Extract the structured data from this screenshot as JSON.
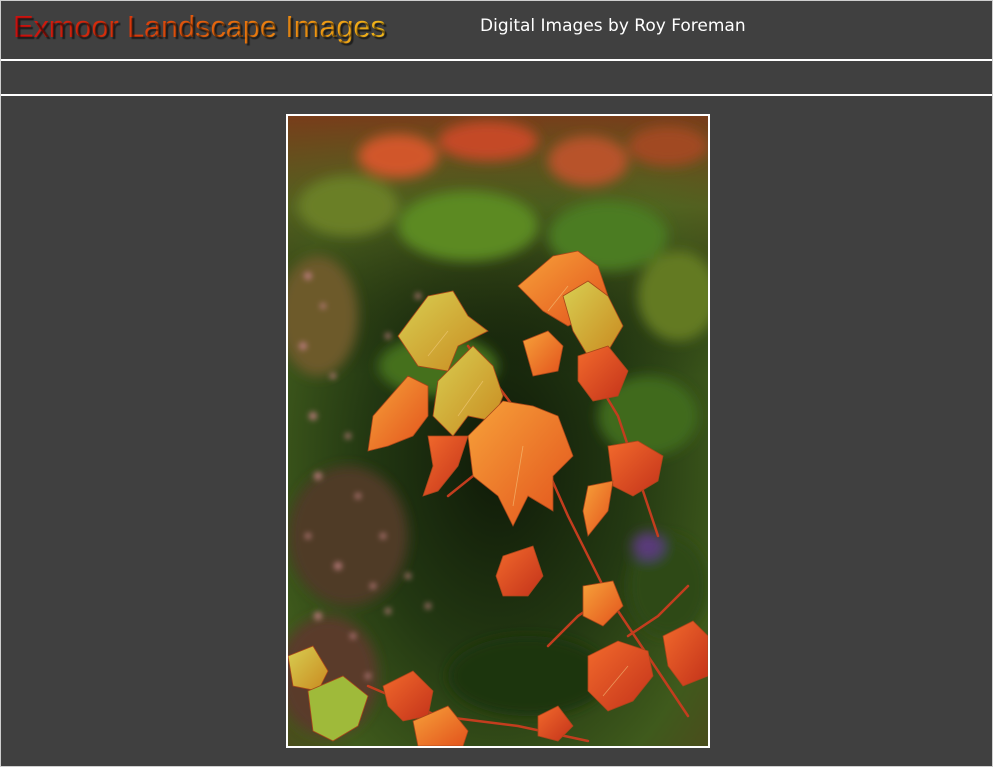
{
  "header": {
    "title": "Exmoor Landscape Images",
    "subtitle": "Digital Images by Roy Foreman"
  },
  "nav": {
    "items": []
  },
  "photo": {
    "subject": "autumn-maple-leaves"
  },
  "colors": {
    "background": "#404040",
    "border": "#ffffff",
    "title_gradient_start": "#c90f0f",
    "title_gradient_end": "#f2b81a",
    "subtitle": "#ffffff"
  }
}
